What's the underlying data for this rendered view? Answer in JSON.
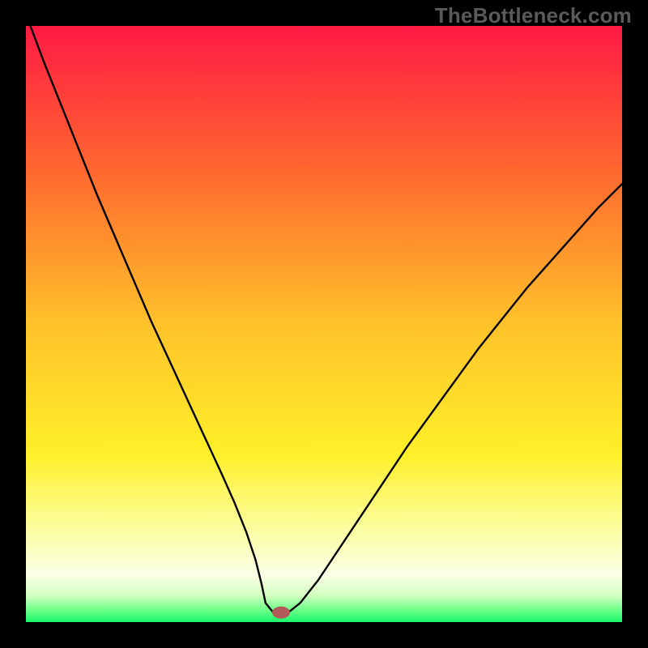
{
  "watermark": "TheBottleneck.com",
  "chart_data": {
    "type": "line",
    "title": "",
    "xlabel": "",
    "ylabel": "",
    "xlim": [
      0,
      100
    ],
    "ylim": [
      0,
      100
    ],
    "grid": false,
    "legend": false,
    "series": [
      {
        "name": "curve",
        "color": "#000000",
        "x": [
          0,
          3,
          6,
          9,
          12,
          15,
          18,
          21,
          24,
          27,
          30,
          33,
          35,
          37,
          38.5,
          39.5,
          40.2,
          41.5,
          43,
          44,
          46,
          49,
          52,
          56,
          60,
          64,
          68,
          72,
          76,
          80,
          84,
          88,
          92,
          96,
          100
        ],
        "values": [
          102,
          94,
          86.5,
          79,
          71.5,
          64.5,
          57.5,
          50.5,
          44,
          37.5,
          31,
          24.5,
          20,
          15,
          10.5,
          6.5,
          3.2,
          1.6,
          1.6,
          1.6,
          3.2,
          7,
          11.5,
          17.5,
          23.5,
          29.5,
          35,
          40.5,
          46,
          51,
          56,
          60.5,
          65,
          69.5,
          73.5
        ]
      }
    ],
    "marker": {
      "x": 42.8,
      "y": 1.6,
      "color": "#b15a58"
    },
    "gradient_stops": [
      {
        "offset": 0.0,
        "color": "#ff1a44"
      },
      {
        "offset": 0.25,
        "color": "#ff6a2f"
      },
      {
        "offset": 0.5,
        "color": "#ffc22a"
      },
      {
        "offset": 0.72,
        "color": "#fff029"
      },
      {
        "offset": 0.86,
        "color": "#fbffb0"
      },
      {
        "offset": 0.92,
        "color": "#fbffe6"
      },
      {
        "offset": 0.955,
        "color": "#d4ffc0"
      },
      {
        "offset": 0.98,
        "color": "#6bff88"
      },
      {
        "offset": 1.0,
        "color": "#19f76b"
      }
    ]
  }
}
